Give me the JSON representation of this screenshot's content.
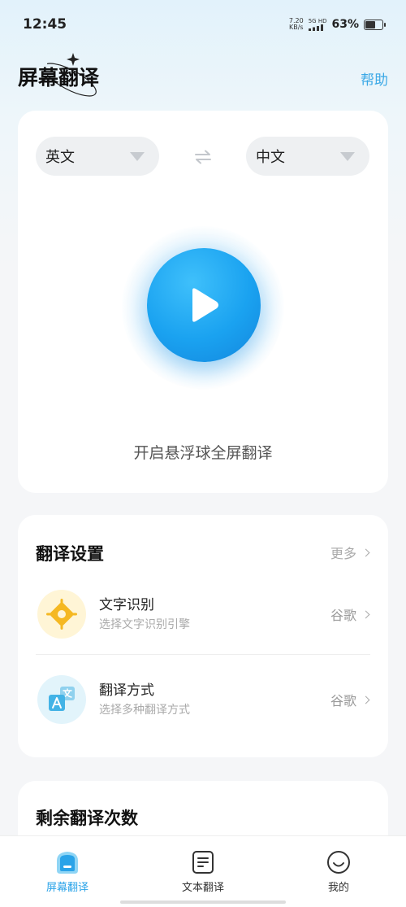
{
  "status_bar": {
    "time": "12:45",
    "net_speed_value": "7.20",
    "net_speed_unit": "KB/s",
    "network_type": "5G HD",
    "battery_percent": "63%",
    "battery_level": 0.63
  },
  "header": {
    "title": "屏幕翻译",
    "help_label": "帮助"
  },
  "translator": {
    "source_language": "英文",
    "target_language": "中文",
    "start_prompt": "开启悬浮球全屏翻译"
  },
  "settings": {
    "title": "翻译设置",
    "more_label": "更多",
    "items": [
      {
        "title": "文字识别",
        "subtitle": "选择文字识别引擎",
        "value": "谷歌",
        "icon": "ocr-target-icon"
      },
      {
        "title": "翻译方式",
        "subtitle": "选择多种翻译方式",
        "value": "谷歌",
        "icon": "translate-icon"
      }
    ]
  },
  "remaining": {
    "title": "剩余翻译次数"
  },
  "bottom_nav": {
    "items": [
      {
        "label": "屏幕翻译",
        "icon": "screen-translate-icon",
        "active": true
      },
      {
        "label": "文本翻译",
        "icon": "document-icon",
        "active": false
      },
      {
        "label": "我的",
        "icon": "smiley-icon",
        "active": false
      }
    ]
  },
  "colors": {
    "accent": "#2aa3e8",
    "play_button": "#1aa2f0",
    "ocr_icon": "#f5b822"
  }
}
